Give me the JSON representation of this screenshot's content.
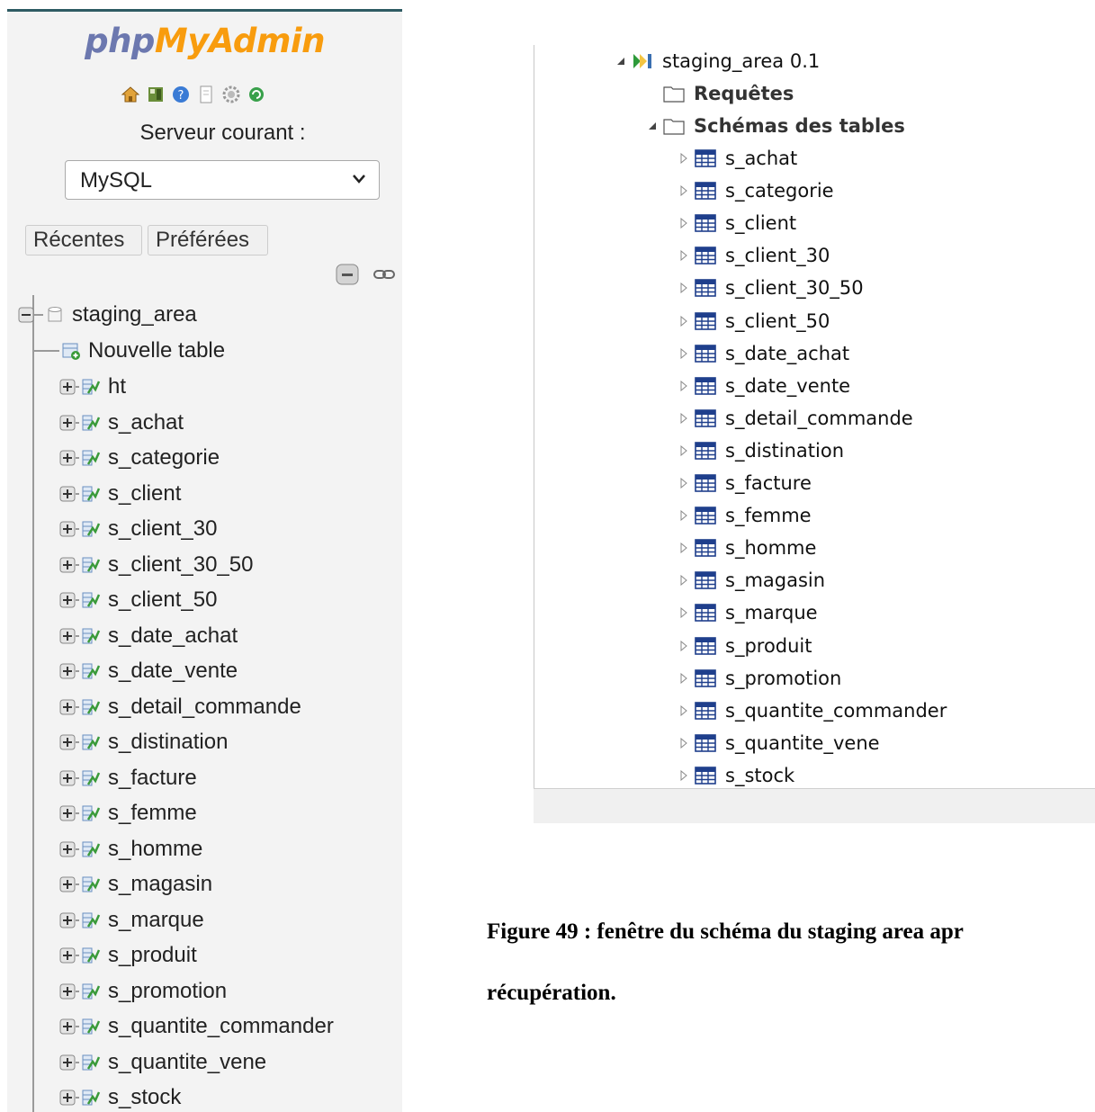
{
  "phpmyadmin": {
    "logo_php": "php",
    "logo_myadmin": "MyAdmin",
    "toolbar_icons": [
      "home-icon",
      "database-icon",
      "help-icon",
      "documentation-icon",
      "settings-icon",
      "reload-icon"
    ],
    "server_label": "Serveur courant :",
    "server_select": "MySQL",
    "tab_recent": "Récentes",
    "tab_favorites": "Préférées",
    "database": "staging_area",
    "new_table": "Nouvelle table",
    "tables": [
      "ht",
      "s_achat",
      "s_categorie",
      "s_client",
      "s_client_30",
      "s_client_30_50",
      "s_client_50",
      "s_date_achat",
      "s_date_vente",
      "s_detail_commande",
      "s_distination",
      "s_facture",
      "s_femme",
      "s_homme",
      "s_magasin",
      "s_marque",
      "s_produit",
      "s_promotion",
      "s_quantite_commander",
      "s_quantite_vene",
      "s_stock"
    ]
  },
  "repository": {
    "project": "staging_area 0.1",
    "folder_queries": "Requêtes",
    "folder_schemas": "Schémas des tables",
    "tables": [
      "s_achat",
      "s_categorie",
      "s_client",
      "s_client_30",
      "s_client_30_50",
      "s_client_50",
      "s_date_achat",
      "s_date_vente",
      "s_detail_commande",
      "s_distination",
      "s_facture",
      "s_femme",
      "s_homme",
      "s_magasin",
      "s_marque",
      "s_produit",
      "s_promotion",
      "s_quantite_commander",
      "s_quantite_vene",
      "s_stock"
    ]
  },
  "caption": {
    "line1": "Figure 49 : fenêtre du schéma du staging area apr",
    "line2": "récupération."
  }
}
